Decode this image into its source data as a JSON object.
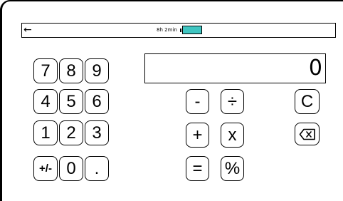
{
  "app": {
    "back_icon": "←",
    "status": {
      "time": "8h 2min",
      "battery_color": "#3fc5c1"
    }
  },
  "display": {
    "value": "0"
  },
  "keys": {
    "k7": "7",
    "k8": "8",
    "k9": "9",
    "k4": "4",
    "k5": "5",
    "k6": "6",
    "k1": "1",
    "k2": "2",
    "k3": "3",
    "negate": "+/-",
    "k0": "0",
    "decimal": ".",
    "minus": "-",
    "divide": "÷",
    "plus": "+",
    "multiply": "x",
    "equals": "=",
    "percent": "%",
    "clear": "C"
  },
  "icons": {
    "backspace": "backspace-icon"
  }
}
